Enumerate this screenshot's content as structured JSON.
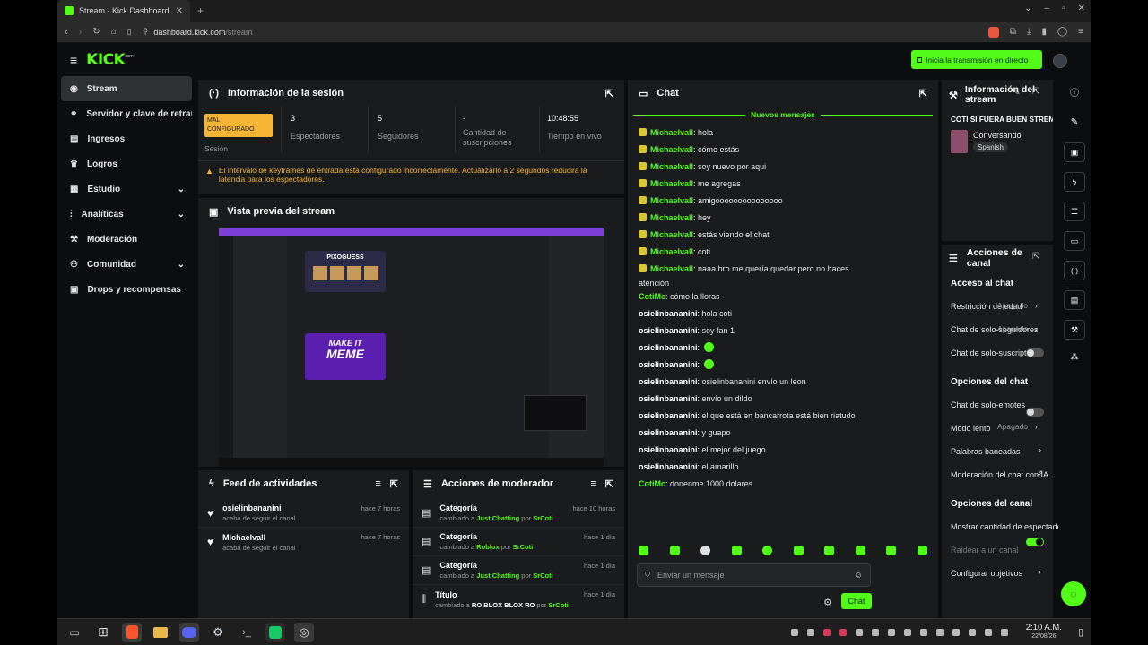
{
  "browser": {
    "tab_title": "Stream - Kick Dashboard",
    "url_host": "dashboard.kick.com",
    "url_path": "/stream"
  },
  "header": {
    "logo": "KICK",
    "logo_beta": "BETA",
    "go_live": "Inicia la transmisión en directo"
  },
  "sidebar": {
    "items": [
      {
        "label": "Stream"
      },
      {
        "label": "Servidor y clave de retran"
      },
      {
        "label": "Ingresos"
      },
      {
        "label": "Logros"
      },
      {
        "label": "Estudio"
      },
      {
        "label": "Analíticas"
      },
      {
        "label": "Moderación"
      },
      {
        "label": "Comunidad"
      },
      {
        "label": "Drops y recompensas"
      }
    ]
  },
  "session": {
    "title": "Información de la sesión",
    "status_line1": "MAL",
    "status_line2": "CONFIGURADO",
    "status_label": "Sesión",
    "stats": [
      {
        "value": "3",
        "label": "Espectadores"
      },
      {
        "value": "5",
        "label": "Seguidores"
      },
      {
        "value": "-",
        "label": "Cantidad de suscripciones"
      },
      {
        "value": "10:48:55",
        "label": "Tiempo en vivo"
      }
    ],
    "warning": "El intervalo de keyframes de entrada está configurado incorrectamente. Actualizarlo a 2 segundos reducirá la latencia para los espectadores."
  },
  "preview": {
    "title": "Vista previa del stream",
    "game_title": "PIXOGUESS",
    "meme_line1": "MAKE IT",
    "meme_line2": "MEME"
  },
  "feed": {
    "title": "Feed de actividades",
    "items": [
      {
        "user": "osielinbananini",
        "action": "acaba de seguir el canal",
        "time": "hace 7 horas"
      },
      {
        "user": "Michaelvall",
        "action": "acaba de seguir el canal",
        "time": "hace 7 horas"
      }
    ]
  },
  "modactions": {
    "title": "Acciones de moderador",
    "items": [
      {
        "title": "Categoría",
        "pre": "cambiado a ",
        "value": "Just Chatting",
        "by": " por ",
        "mod": "SrCoti",
        "time": "hace 10 horas"
      },
      {
        "title": "Categoría",
        "pre": "cambiado a ",
        "value": "Roblox",
        "by": " por ",
        "mod": "SrCoti",
        "time": "hace 1 día"
      },
      {
        "title": "Categoría",
        "pre": "cambiado a ",
        "value": "Just Chatting",
        "by": " por ",
        "mod": "SrCoti",
        "time": "hace 1 día"
      },
      {
        "title": "Título",
        "pre": "cambiado a ",
        "value": "RO BLOX BLOX RO",
        "by": " por ",
        "mod": "SrCoti",
        "time": "hace 1 día"
      }
    ]
  },
  "chat": {
    "title": "Chat",
    "new_messages": "Nuevos mensajes",
    "messages": [
      {
        "user": "Michaelvall",
        "text": "hola"
      },
      {
        "user": "Michaelvall",
        "text": "cómo estás"
      },
      {
        "user": "Michaelvall",
        "text": "soy nuevo por aqui"
      },
      {
        "user": "Michaelvall",
        "text": "me agregas"
      },
      {
        "user": "Michaelvall",
        "text": "amigooooooooooooooo"
      },
      {
        "user": "Michaelvall",
        "text": "hey"
      },
      {
        "user": "Michaelvall",
        "text": "estás viendo el chat"
      },
      {
        "user": "Michaelvall",
        "text": "coti"
      },
      {
        "user": "Michaelvall",
        "text": "naaa bro me quería quedar pero no haces"
      },
      {
        "user": "",
        "text": "atención"
      },
      {
        "user": "CotiMc",
        "text": "cómo la lloras"
      },
      {
        "user": "osielinbananini",
        "text": "hola coti"
      },
      {
        "user": "osielinbananini",
        "text": "soy fan 1"
      },
      {
        "user": "osielinbananini",
        "text": ""
      },
      {
        "user": "osielinbananini",
        "text": ""
      },
      {
        "user": "osielinbananini",
        "text": "osielinbananini envío un leon"
      },
      {
        "user": "osielinbananini",
        "text": "envío un dildo"
      },
      {
        "user": "osielinbananini",
        "text": "el que está en bancarrota está bien riatudo"
      },
      {
        "user": "osielinbananini",
        "text": "y guapo"
      },
      {
        "user": "osielinbananini",
        "text": "el mejor del juego"
      },
      {
        "user": "osielinbananini",
        "text": "el amarillo"
      },
      {
        "user": "CotiMc",
        "text": "donenme 1000 dolares"
      }
    ],
    "input_placeholder": "Enviar un mensaje",
    "send": "Chat"
  },
  "streaminfo": {
    "title_line1": "Información del",
    "title_line2": "stream",
    "stream_title": "COTI SI FUERA BUEN STREMER: COTI",
    "category": "Conversando",
    "language": "Spanish"
  },
  "channel": {
    "title": "Acciones de canal",
    "sec_access": "Acceso al chat",
    "age": "Restricción de edad",
    "age_value": "Apagado",
    "followers": "Chat de solo-seguidores",
    "followers_value": "Apagado",
    "subs": "Chat de solo-suscriptores",
    "sec_chat": "Opciones del chat",
    "emotes": "Chat de solo-emotes",
    "slow": "Modo lento",
    "slow_value": "Apagado",
    "banned": "Palabras baneadas",
    "ai_mod": "Moderación del chat con IA",
    "sec_channel": "Opciones del canal",
    "viewers": "Mostrar cantidad de espectadores",
    "raid": "Raidear a un canal",
    "goals": "Configurar objetivos"
  },
  "taskbar": {
    "time": "2:10 A.M.",
    "date": "22/08/26"
  },
  "colors": {
    "accent": "#53fc18",
    "warning": "#f5b433",
    "panel": "#191b1c"
  }
}
